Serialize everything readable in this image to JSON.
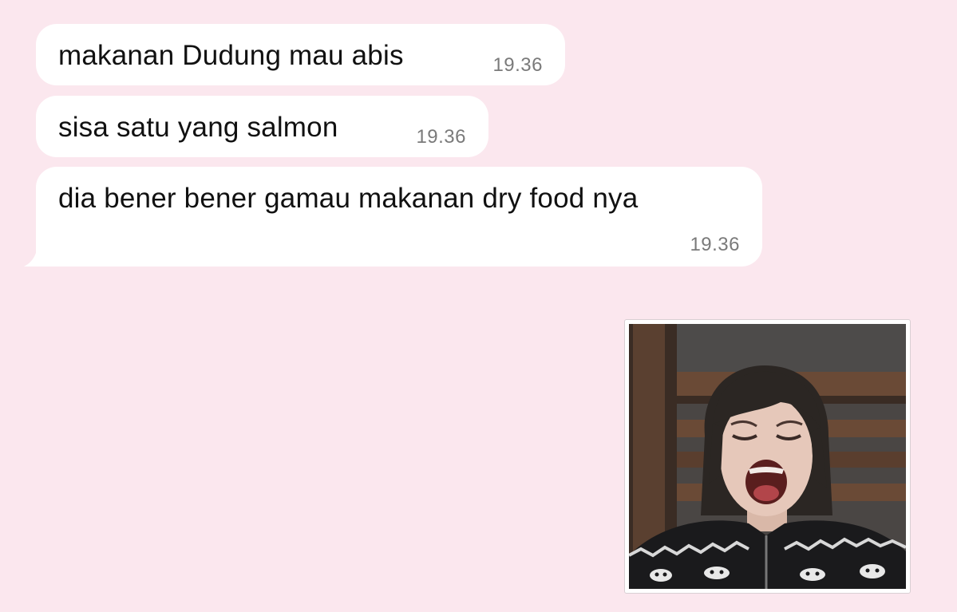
{
  "messages": [
    {
      "text": "makanan Dudung mau abis",
      "time": "19.36"
    },
    {
      "text": "sisa satu yang salmon",
      "time": "19.36"
    },
    {
      "text": "dia bener bener gamau makanan dry food nya",
      "time": "19.36"
    }
  ],
  "sticker": {
    "description_icon": "crying-person-sticker"
  },
  "colors": {
    "background": "#fbe7ee",
    "bubble": "#ffffff",
    "text": "#111111",
    "timestamp": "#7a7a7a"
  }
}
